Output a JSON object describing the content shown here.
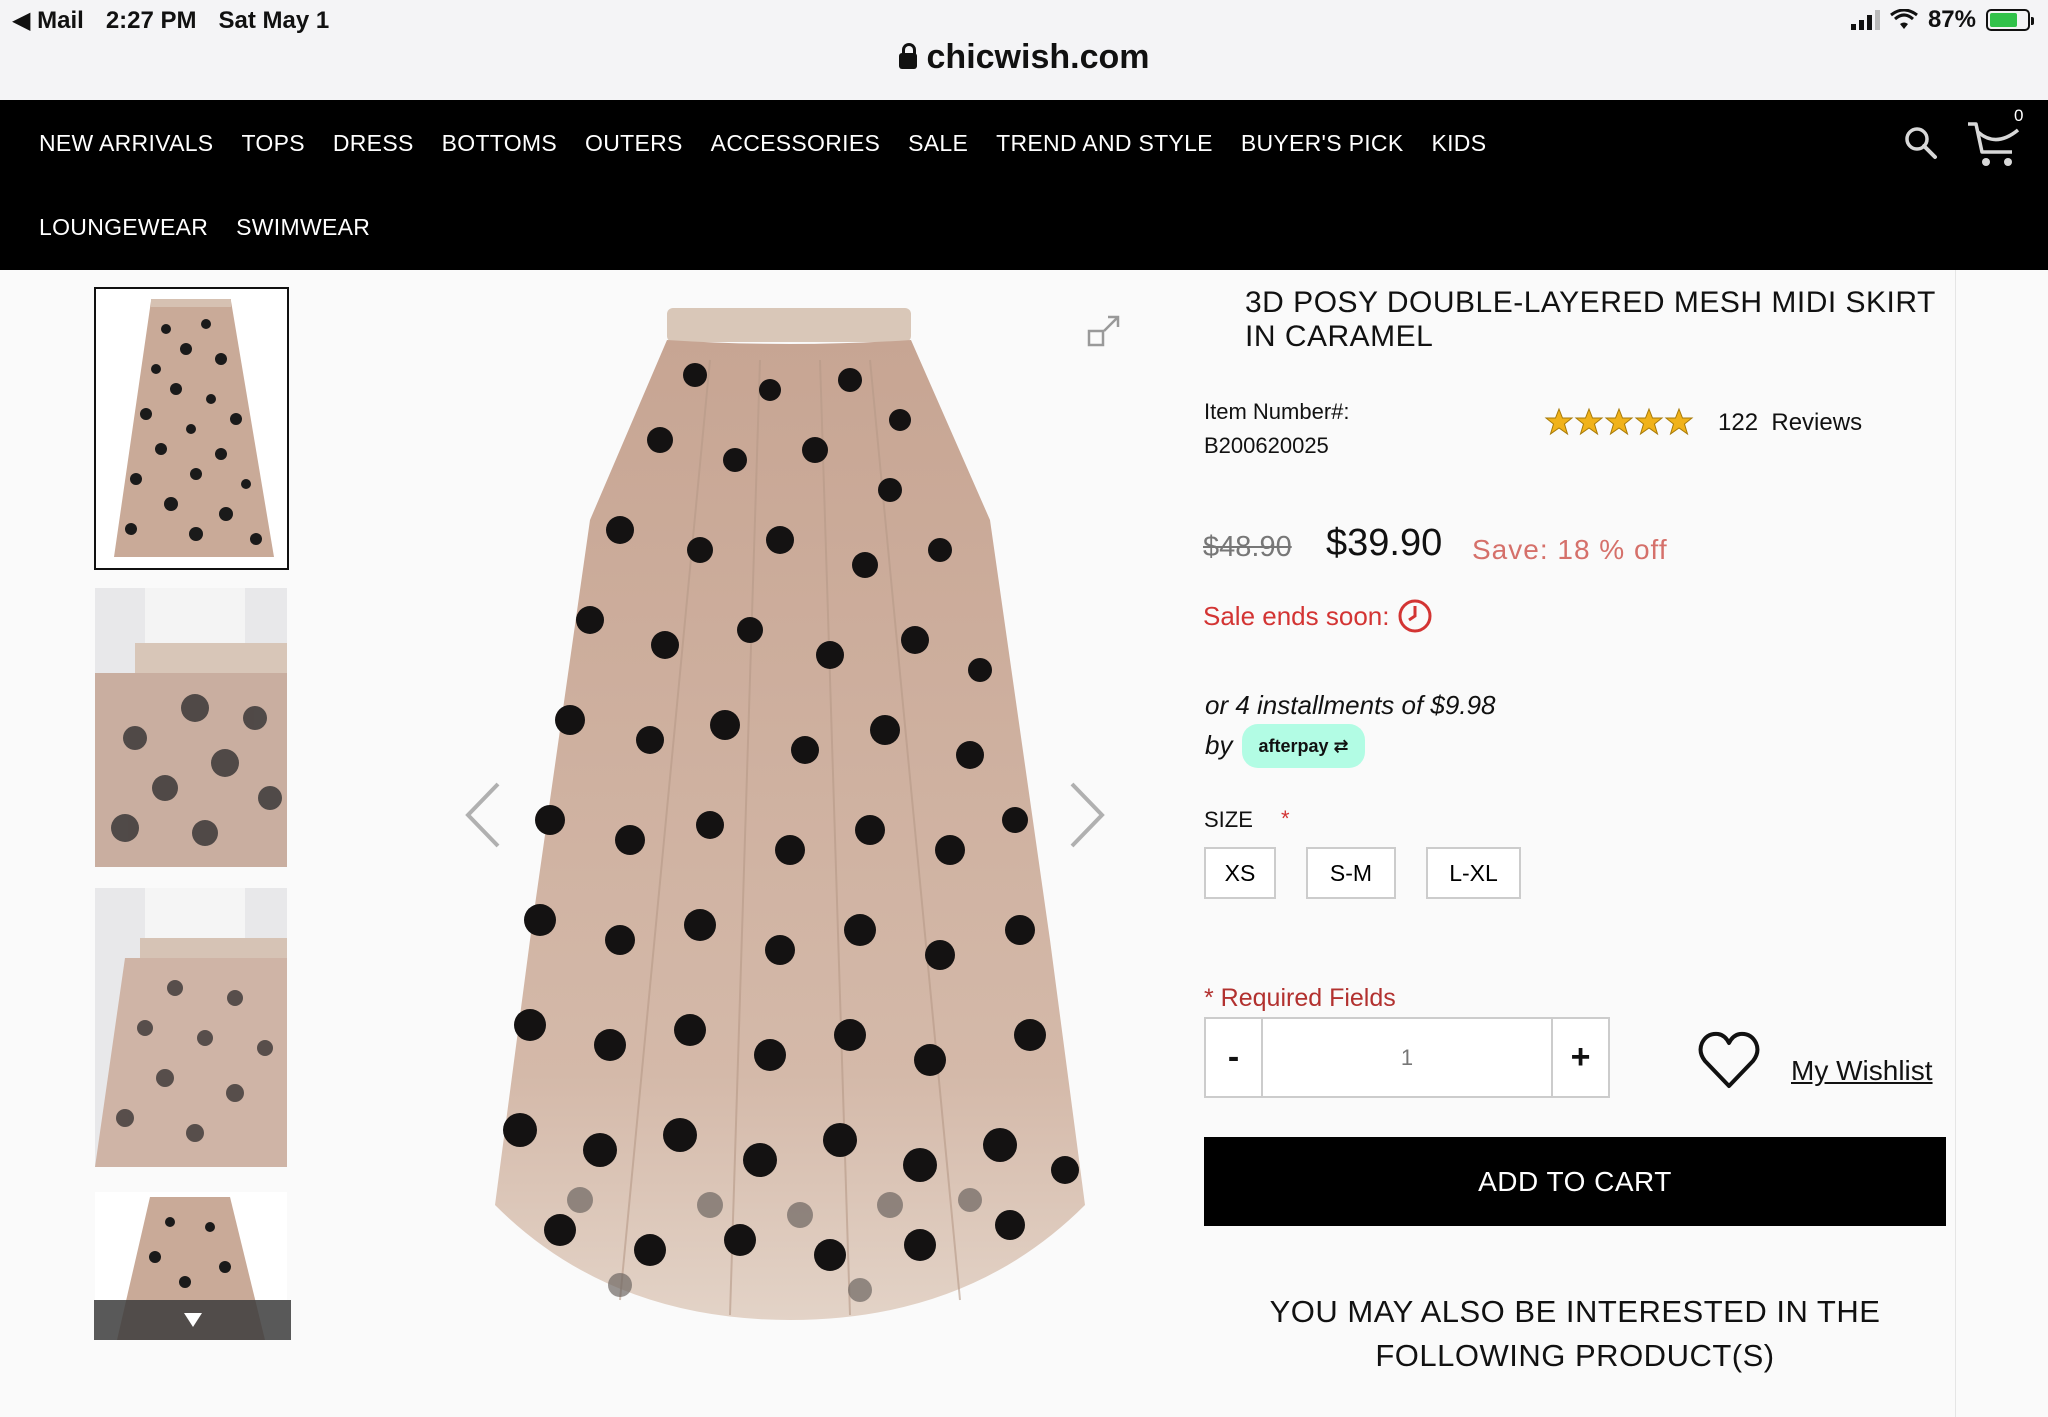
{
  "status_bar": {
    "back_app": "Mail",
    "time": "2:27 PM",
    "date": "Sat May 1",
    "battery": "87%"
  },
  "browser": {
    "url": "chicwish.com"
  },
  "nav": {
    "row1": [
      "NEW ARRIVALS",
      "TOPS",
      "DRESS",
      "BOTTOMS",
      "OUTERS",
      "ACCESSORIES",
      "SALE",
      "TREND AND STYLE",
      "BUYER'S PICK",
      "KIDS"
    ],
    "row2": [
      "LOUNGEWEAR",
      "SWIMWEAR"
    ],
    "cart_count": "0"
  },
  "product": {
    "title": "3D POSY DOUBLE-LAYERED MESH MIDI SKIRT IN CARAMEL",
    "item_number_label": "Item Number#:",
    "item_number": "B200620025",
    "rating_stars": 5,
    "reviews": "122  Reviews",
    "old_price": "$48.90",
    "price": "$39.90",
    "save": "Save: 18 % off",
    "sale_ends": "Sale ends soon:",
    "installments": "or 4 installments of $9.98",
    "by": "by",
    "afterpay": "afterpay",
    "size_label": "SIZE",
    "size_required": "*",
    "sizes": [
      "XS",
      "S-M",
      "L-XL"
    ],
    "required_fields": "* Required Fields",
    "qty_minus": "-",
    "qty_plus": "+",
    "quantity": "1",
    "wishlist": "My Wishlist",
    "add_to_cart": "ADD TO CART",
    "also_interested": "YOU MAY ALSO BE INTERESTED IN THE FOLLOWING PRODUCT(S)"
  },
  "colors": {
    "nav_bg": "#000000",
    "sale_red": "#d33433",
    "save_coral": "#d5706a",
    "afterpay_mint": "#b2fce4",
    "star_gold": "#f0b21a",
    "skirt_tan": "#d9b9a6"
  }
}
